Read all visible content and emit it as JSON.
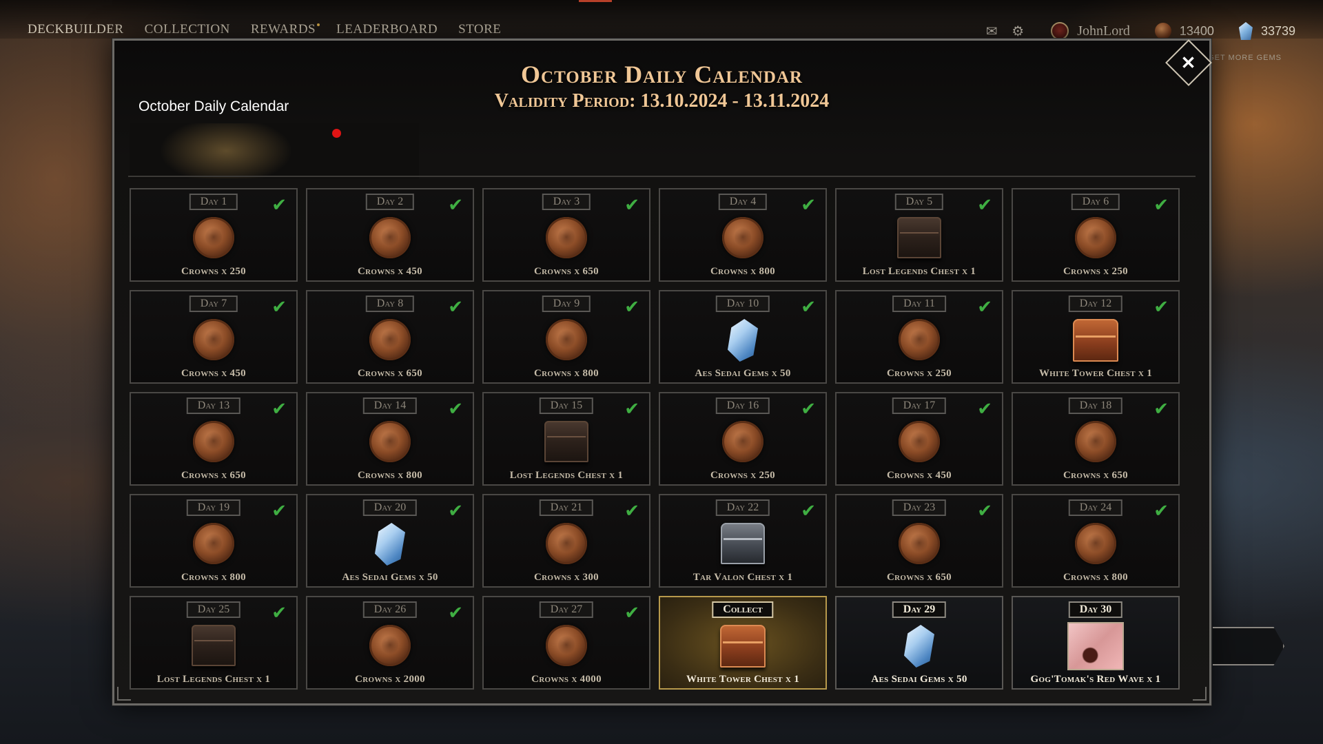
{
  "nav": {
    "items": [
      "DECKBUILDER",
      "COLLECTION",
      "REWARDS",
      "LEADERBOARD",
      "STORE"
    ]
  },
  "header": {
    "username": "JohnLord",
    "crowns": "13400",
    "gems": "33739",
    "get_more_gems": "GET MORE GEMS"
  },
  "modal": {
    "title": "October Daily Calendar",
    "subtitle": "Validity Period: 13.10.2024 - 13.11.2024",
    "tab_label": "October Daily Calendar",
    "close_label": "✕"
  },
  "calendar": [
    {
      "day": "Day 1",
      "reward": "Crowns  x 250",
      "icon": "coin",
      "state": "claimed"
    },
    {
      "day": "Day 2",
      "reward": "Crowns  x 450",
      "icon": "coin",
      "state": "claimed"
    },
    {
      "day": "Day 3",
      "reward": "Crowns  x 650",
      "icon": "coin",
      "state": "claimed"
    },
    {
      "day": "Day 4",
      "reward": "Crowns  x 800",
      "icon": "coin",
      "state": "claimed"
    },
    {
      "day": "Day 5",
      "reward": "Lost Legends Chest  x 1",
      "icon": "chest",
      "state": "claimed"
    },
    {
      "day": "Day 6",
      "reward": "Crowns  x 250",
      "icon": "coin",
      "state": "claimed"
    },
    {
      "day": "Day 7",
      "reward": "Crowns  x 450",
      "icon": "coin",
      "state": "claimed"
    },
    {
      "day": "Day 8",
      "reward": "Crowns  x 650",
      "icon": "coin",
      "state": "claimed"
    },
    {
      "day": "Day 9",
      "reward": "Crowns  x 800",
      "icon": "coin",
      "state": "claimed"
    },
    {
      "day": "Day 10",
      "reward": "Aes Sedai Gems  x 50",
      "icon": "gem",
      "state": "claimed"
    },
    {
      "day": "Day 11",
      "reward": "Crowns  x 250",
      "icon": "coin",
      "state": "claimed"
    },
    {
      "day": "Day 12",
      "reward": "White Tower Chest  x 1",
      "icon": "chest-white",
      "state": "claimed"
    },
    {
      "day": "Day 13",
      "reward": "Crowns  x 650",
      "icon": "coin",
      "state": "claimed"
    },
    {
      "day": "Day 14",
      "reward": "Crowns  x 800",
      "icon": "coin",
      "state": "claimed"
    },
    {
      "day": "Day 15",
      "reward": "Lost Legends Chest  x 1",
      "icon": "chest",
      "state": "claimed"
    },
    {
      "day": "Day 16",
      "reward": "Crowns  x 250",
      "icon": "coin",
      "state": "claimed"
    },
    {
      "day": "Day 17",
      "reward": "Crowns  x 450",
      "icon": "coin",
      "state": "claimed"
    },
    {
      "day": "Day 18",
      "reward": "Crowns  x 650",
      "icon": "coin",
      "state": "claimed"
    },
    {
      "day": "Day 19",
      "reward": "Crowns  x 800",
      "icon": "coin",
      "state": "claimed"
    },
    {
      "day": "Day 20",
      "reward": "Aes Sedai Gems  x 50",
      "icon": "gem",
      "state": "claimed"
    },
    {
      "day": "Day 21",
      "reward": "Crowns  x 300",
      "icon": "coin",
      "state": "claimed"
    },
    {
      "day": "Day 22",
      "reward": "Tar Valon Chest  x 1",
      "icon": "chest-tar",
      "state": "claimed"
    },
    {
      "day": "Day 23",
      "reward": "Crowns  x 650",
      "icon": "coin",
      "state": "claimed"
    },
    {
      "day": "Day 24",
      "reward": "Crowns  x 800",
      "icon": "coin",
      "state": "claimed"
    },
    {
      "day": "Day 25",
      "reward": "Lost Legends Chest  x 1",
      "icon": "chest",
      "state": "claimed"
    },
    {
      "day": "Day 26",
      "reward": "Crowns  x 2000",
      "icon": "coin",
      "state": "claimed"
    },
    {
      "day": "Day 27",
      "reward": "Crowns  x 4000",
      "icon": "coin",
      "state": "claimed"
    },
    {
      "day": "Collect",
      "reward": "White Tower Chest  x 1",
      "icon": "chest-white",
      "state": "collect"
    },
    {
      "day": "Day 29",
      "reward": "Aes Sedai Gems  x 50",
      "icon": "gem",
      "state": "future"
    },
    {
      "day": "Day 30",
      "reward": "Gog'Tomak's Red Wave  x 1",
      "icon": "card",
      "state": "future"
    }
  ],
  "colors": {
    "title_gold": "#f0c796",
    "check_green": "#3fae42",
    "notification_red": "#e01414",
    "collect_gold": "#b89a4c"
  }
}
